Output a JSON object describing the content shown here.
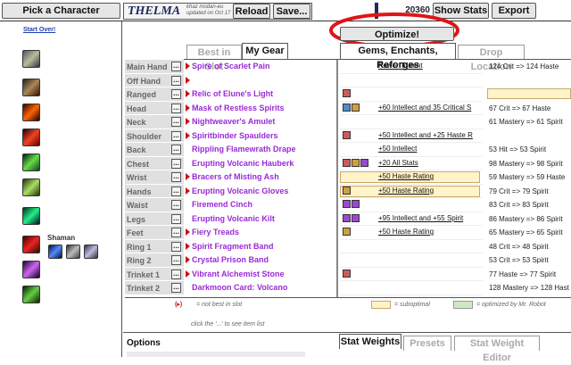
{
  "topbar": {
    "pick_character": "Pick a Character",
    "character_name": "THELMA",
    "character_realm": "khaz modan-eu",
    "updated": "updated on Oct 17",
    "reload": "Reload",
    "save": "Save...",
    "score": "20360",
    "show_stats": "Show Stats",
    "export": "Export"
  },
  "sidebar": {
    "start_over": "Start Over!",
    "class_label": "Shaman"
  },
  "optimize_label": "Optimize!",
  "gear_tabs": [
    "Best in Slot",
    "My Gear"
  ],
  "right_tabs": [
    "Gems, Enchants, Reforges",
    "Drop Location"
  ],
  "gear": [
    {
      "slot": "Main Hand",
      "item": "Spire of Scarlet Pain",
      "enchant": "Power Torrent",
      "reforge": "124 Crit => 124 Haste",
      "gems": [],
      "tri": true,
      "hl": false
    },
    {
      "slot": "Off Hand",
      "item": "",
      "enchant": "",
      "reforge": "",
      "gems": [],
      "tri": true,
      "hl": false
    },
    {
      "slot": "Ranged",
      "item": "Relic of Elune's Light",
      "enchant": "",
      "reforge": "",
      "gems": [
        "#d05a5a"
      ],
      "tri": true,
      "hl": false
    },
    {
      "slot": "Head",
      "item": "Mask of Restless Spirits",
      "enchant": "+60 Intellect and 35 Critical S",
      "reforge": "67 Crit => 67 Haste",
      "gems": [
        "#4a8fd0",
        "#d0a040"
      ],
      "tri": true,
      "hl": false
    },
    {
      "slot": "Neck",
      "item": "Nightweaver's Amulet",
      "enchant": "",
      "reforge": "61 Mastery => 61 Spirit",
      "gems": [],
      "tri": true,
      "hl": false
    },
    {
      "slot": "Shoulder",
      "item": "Spiritbinder Spaulders",
      "enchant": "+50 Intellect and +25 Haste R",
      "reforge": "",
      "gems": [
        "#d05a5a"
      ],
      "tri": true,
      "hl": false
    },
    {
      "slot": "Back",
      "item": "Rippling Flamewrath Drape",
      "enchant": "+50 Intellect",
      "reforge": "53 Hit => 53 Spirit",
      "gems": [],
      "tri": false,
      "hl": false
    },
    {
      "slot": "Chest",
      "item": "Erupting Volcanic Hauberk",
      "enchant": "+20 All Stats",
      "reforge": "98 Mastery => 98 Spirit",
      "gems": [
        "#d05a5a",
        "#d0a040",
        "#9a4ad0"
      ],
      "tri": false,
      "hl": false
    },
    {
      "slot": "Wrist",
      "item": "Bracers of Misting Ash",
      "enchant": "+50 Haste Rating",
      "reforge": "59 Mastery => 59 Haste",
      "gems": [],
      "tri": true,
      "hl": true
    },
    {
      "slot": "Hands",
      "item": "Erupting Volcanic Gloves",
      "enchant": "+50 Haste Rating",
      "reforge": "79 Crit => 79 Spirit",
      "gems": [
        "#d0a040"
      ],
      "tri": true,
      "hl": true
    },
    {
      "slot": "Waist",
      "item": "Firemend Cinch",
      "enchant": "",
      "reforge": "83 Crit => 83 Spirit",
      "gems": [
        "#9a4ad0",
        "#9a4ad0"
      ],
      "tri": false,
      "hl": false
    },
    {
      "slot": "Legs",
      "item": "Erupting Volcanic Kilt",
      "enchant": "+95 Intellect and +55 Spirit",
      "reforge": "86 Mastery => 86 Spirit",
      "gems": [
        "#9a4ad0",
        "#9a4ad0"
      ],
      "tri": false,
      "hl": false
    },
    {
      "slot": "Feet",
      "item": "Fiery Treads",
      "enchant": "+50 Haste Rating",
      "reforge": "65 Mastery => 65 Spirit",
      "gems": [
        "#d0a040"
      ],
      "tri": true,
      "hl": false
    },
    {
      "slot": "Ring 1",
      "item": "Spirit Fragment Band",
      "enchant": "",
      "reforge": "48 Crit => 48 Spirit",
      "gems": [],
      "tri": true,
      "hl": false
    },
    {
      "slot": "Ring 2",
      "item": "Crystal Prison Band",
      "enchant": "",
      "reforge": "53 Crit => 53 Spirit",
      "gems": [],
      "tri": true,
      "hl": false
    },
    {
      "slot": "Trinket 1",
      "item": "Vibrant Alchemist Stone",
      "enchant": "",
      "reforge": "77 Haste => 77 Spirit",
      "gems": [
        "#d05a5a"
      ],
      "tri": true,
      "hl": false
    },
    {
      "slot": "Trinket 2",
      "item": "Darkmoon Card: Volcano",
      "enchant": "",
      "reforge": "128 Mastery => 128 Hast",
      "gems": [],
      "tri": false,
      "hl": false
    }
  ],
  "legend": {
    "not_best": "= not best in slot",
    "click_dots": "click the '...' to see item list",
    "suboptimal": "= suboptimal",
    "optimized": "= optimized by Mr. Robot"
  },
  "bottom": {
    "options": "Options",
    "tabs": [
      "Stat Weights",
      "Presets",
      "Stat Weight Editor"
    ]
  },
  "colors": {
    "item_purple": "#9a2ad6",
    "red_marker": "#d01010",
    "highlight": "#fff3c9",
    "optimized": "#cfe8c4",
    "annotation_circle": "#e01515"
  }
}
